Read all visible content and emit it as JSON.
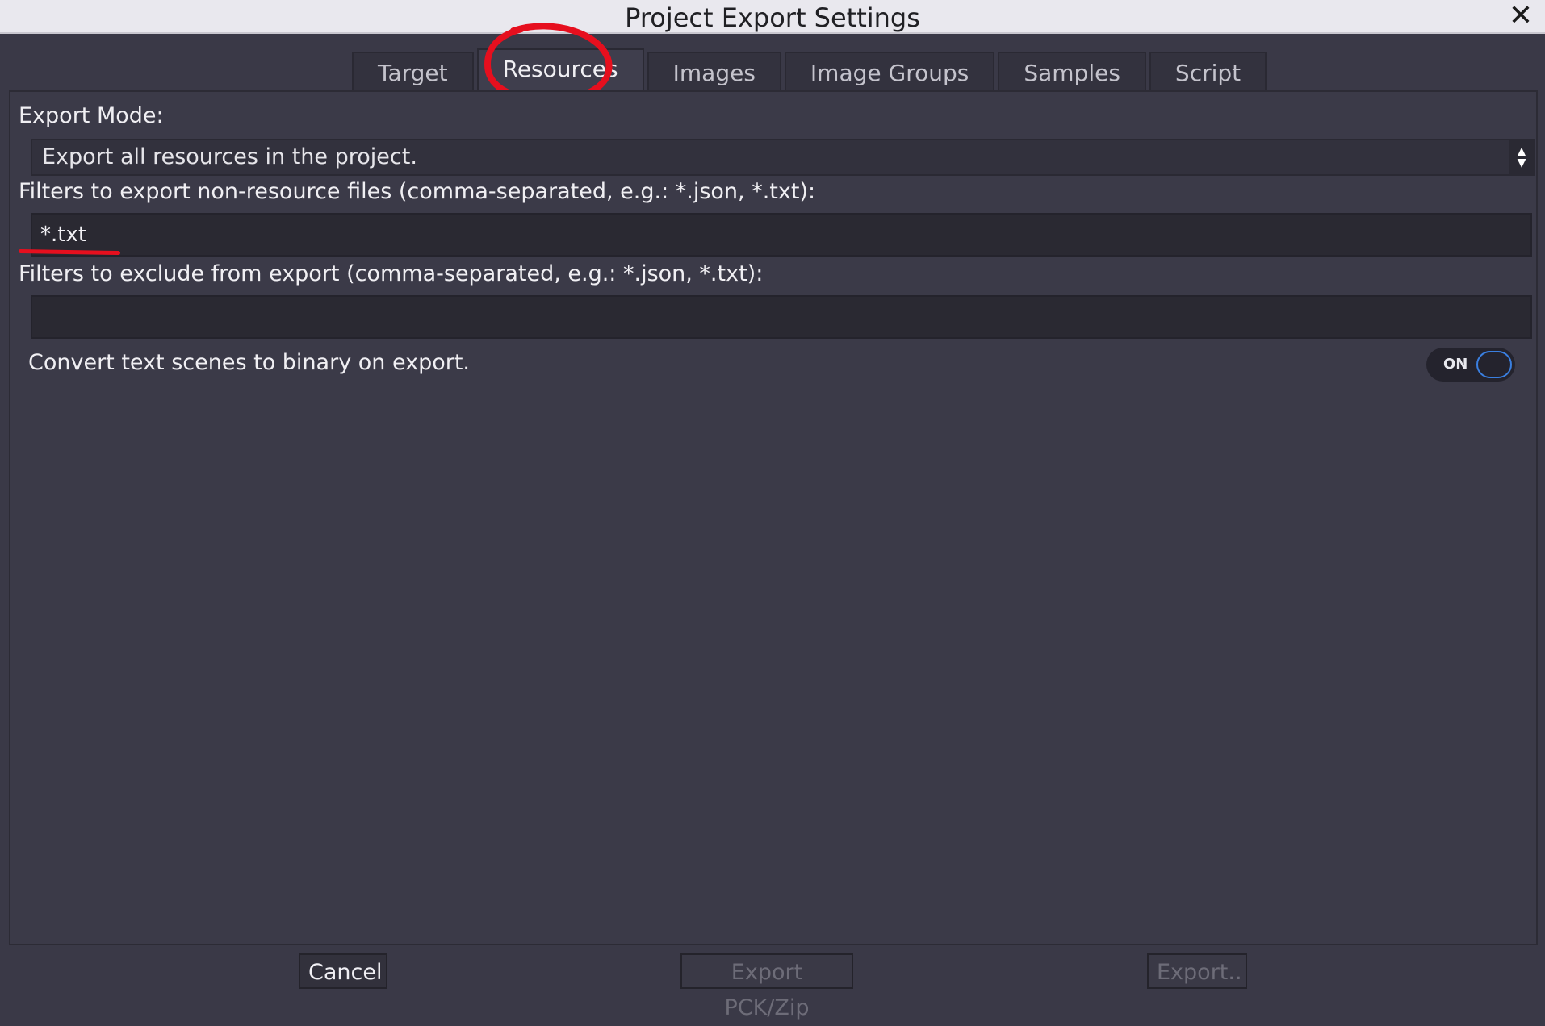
{
  "window": {
    "title": "Project Export Settings",
    "close_glyph": "✕"
  },
  "tabs": [
    {
      "label": "Target",
      "active": false
    },
    {
      "label": "Resources",
      "active": true
    },
    {
      "label": "Images",
      "active": false
    },
    {
      "label": "Image Groups",
      "active": false
    },
    {
      "label": "Samples",
      "active": false
    },
    {
      "label": "Script",
      "active": false
    }
  ],
  "resources": {
    "export_mode_label": "Export Mode:",
    "export_mode_value": "Export all resources in the project.",
    "include_filters_label": "Filters to export non-resource files (comma-separated, e.g.: *.json, *.txt):",
    "include_filters_value": "*.txt",
    "exclude_filters_label": "Filters to exclude from export (comma-separated, e.g.: *.json, *.txt):",
    "exclude_filters_value": "",
    "convert_scenes_label": "Convert text scenes to binary on export.",
    "convert_scenes_toggle": "ON"
  },
  "footer": {
    "cancel_label": "Cancel",
    "export_pck_label": "Export PCK/Zip",
    "export_label": "Export.."
  },
  "colors": {
    "annotation": "#e60f1e",
    "toggle_accent": "#3a7fe0",
    "background": "#3a3947"
  }
}
